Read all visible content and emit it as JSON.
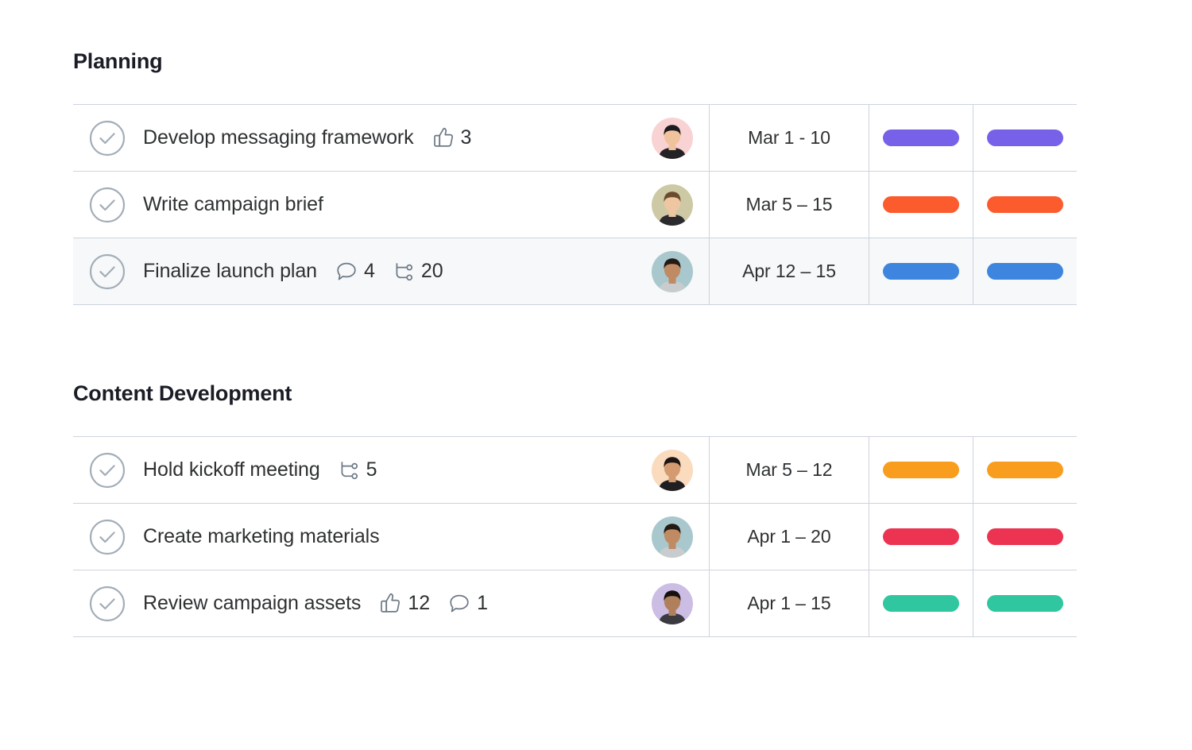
{
  "sections": [
    {
      "title": "Planning",
      "rows": [
        {
          "check_icon": "check-circle-icon",
          "name": "Develop messaging framework",
          "meta": [
            {
              "icon": "thumbs-up-icon",
              "count": "3"
            }
          ],
          "avatar": {
            "name": "avatar-person-1",
            "bg": "#f9d2d4",
            "skin": "#f0c39c",
            "hair": "#1c1c1e",
            "shirt": "#232326"
          },
          "date": "Mar 1 - 10",
          "pill_color": "#7661e8",
          "highlighted": false
        },
        {
          "check_icon": "check-circle-icon",
          "name": "Write campaign brief",
          "meta": [],
          "avatar": {
            "name": "avatar-person-2",
            "bg": "#cdc9a5",
            "skin": "#efc6a2",
            "hair": "#6b4b2e",
            "shirt": "#2b2b2f"
          },
          "date": "Mar 5 – 15",
          "pill_color": "#fb5b2d",
          "highlighted": false
        },
        {
          "check_icon": "check-circle-icon",
          "name": "Finalize launch plan",
          "meta": [
            {
              "icon": "comment-icon",
              "count": "4"
            },
            {
              "icon": "subtask-icon",
              "count": "20"
            }
          ],
          "avatar": {
            "name": "avatar-person-3",
            "bg": "#a8c8cd",
            "skin": "#c08a63",
            "hair": "#241a14",
            "shirt": "#c9ccce"
          },
          "date": "Apr 12 – 15",
          "pill_color": "#3d85de",
          "highlighted": true
        }
      ]
    },
    {
      "title": "Content Development",
      "rows": [
        {
          "check_icon": "check-circle-icon",
          "name": "Hold kickoff meeting",
          "meta": [
            {
              "icon": "subtask-icon",
              "count": "5"
            }
          ],
          "avatar": {
            "name": "avatar-person-4",
            "bg": "#fadbbe",
            "skin": "#d59b70",
            "hair": "#1d1512",
            "shirt": "#1f1f22"
          },
          "date": "Mar 5 – 12",
          "pill_color": "#f99d1e",
          "highlighted": false
        },
        {
          "check_icon": "check-circle-icon",
          "name": "Create marketing materials",
          "meta": [],
          "avatar": {
            "name": "avatar-person-5",
            "bg": "#a8c8cd",
            "skin": "#c08a63",
            "hair": "#241a14",
            "shirt": "#c9ccce"
          },
          "date": "Apr 1 – 20",
          "pill_color": "#ec3352",
          "highlighted": false
        },
        {
          "check_icon": "check-circle-icon",
          "name": "Review campaign assets",
          "meta": [
            {
              "icon": "thumbs-up-icon",
              "count": "12"
            },
            {
              "icon": "comment-icon",
              "count": "1"
            }
          ],
          "avatar": {
            "name": "avatar-person-6",
            "bg": "#cbbde4",
            "skin": "#b0805c",
            "hair": "#15100f",
            "shirt": "#3a3a40"
          },
          "date": "Apr 1 – 15",
          "pill_color": "#2fc6a0",
          "highlighted": false
        }
      ]
    }
  ],
  "theme": {
    "background": "#ffffff",
    "border": "#ccd4de",
    "row_highlight": "#f6f8f9",
    "title_color": "#1b1d26",
    "text_color": "#2e3133",
    "icon_color": "#6b7885",
    "check_color": "#a3adb8"
  }
}
